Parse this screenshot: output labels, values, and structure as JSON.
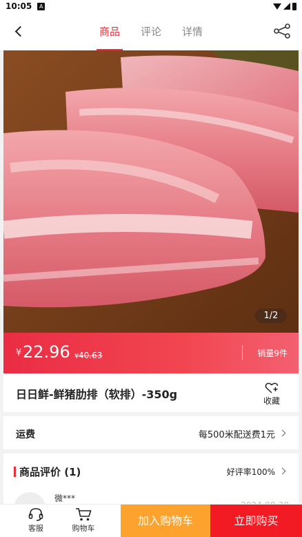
{
  "status_bar": {
    "time": "10:05",
    "notification_badge": "A"
  },
  "header": {
    "tabs": [
      {
        "label": "商品",
        "active": true
      },
      {
        "label": "评论",
        "active": false
      },
      {
        "label": "详情",
        "active": false
      }
    ],
    "back_icon": "chevron-left-icon",
    "share_icon": "share-icon"
  },
  "gallery": {
    "counter": "1/2"
  },
  "price": {
    "currency": "¥",
    "current": "22.96",
    "original_currency": "¥",
    "original": "40.63",
    "sales": "销量9件"
  },
  "product": {
    "title": "日日鲜-鲜猪肋排（软排）-350g",
    "favorite_label": "收藏"
  },
  "shipping": {
    "label": "运费",
    "value": "每500米配送费1元"
  },
  "reviews": {
    "title": "商品评价 (1)",
    "rate": "好评率100%",
    "first": {
      "user": "微***",
      "date": "2024-08-30"
    }
  },
  "bottom": {
    "service_label": "客服",
    "cart_label": "购物车",
    "add_cart": "加入购物车",
    "buy_now": "立即购买"
  },
  "colors": {
    "accent": "#e8303a",
    "orange": "#fca22d",
    "buy_red": "#f21a23"
  }
}
